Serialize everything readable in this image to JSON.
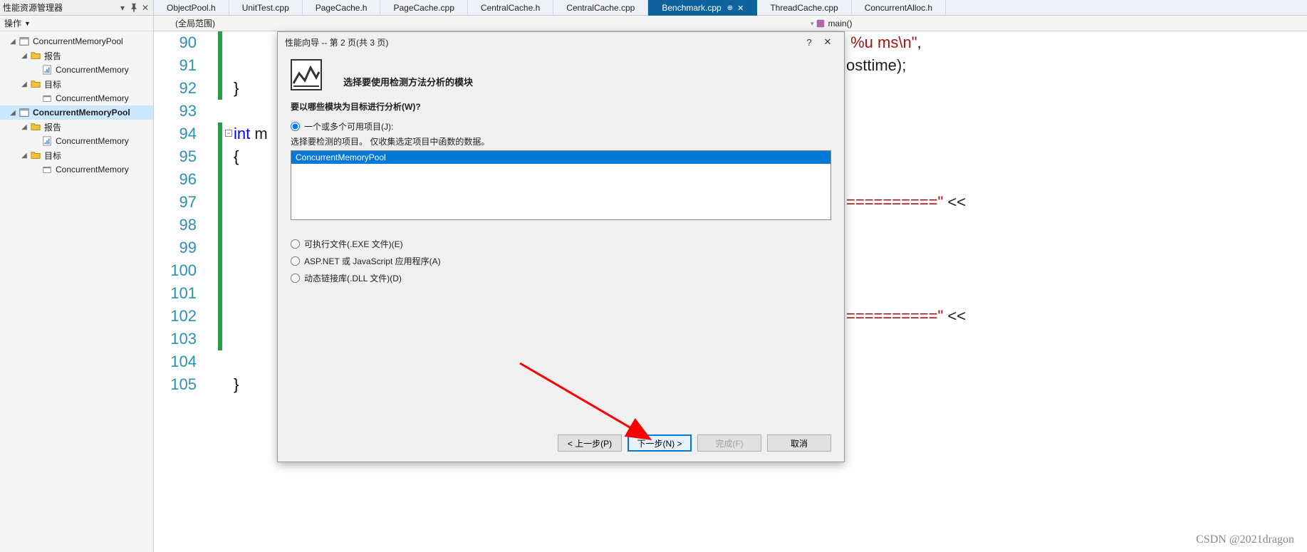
{
  "panel": {
    "title": "性能资源管理器",
    "ops": "操作",
    "tree": {
      "root1": "ConcurrentMemoryPool ",
      "reports": "报告",
      "report_item": "ConcurrentMemory",
      "targets": "目标",
      "target_item": "ConcurrentMemory",
      "root2": "ConcurrentMemoryPool",
      "reports2": "报告",
      "report_item2": "ConcurrentMemory",
      "targets2": "目标",
      "target_item2": "ConcurrentMemory"
    }
  },
  "tabs": [
    {
      "label": "ObjectPool.h"
    },
    {
      "label": "UnitTest.cpp"
    },
    {
      "label": "PageCache.h"
    },
    {
      "label": "PageCache.cpp"
    },
    {
      "label": "CentralCache.h"
    },
    {
      "label": "CentralCache.cpp"
    },
    {
      "label": "Benchmark.cpp",
      "active": true
    },
    {
      "label": "ThreadCache.cpp"
    },
    {
      "label": "ConcurrentAlloc.h"
    }
  ],
  "subbar": {
    "scope": "(全局范围)",
    "func": "main()"
  },
  "gutter": [
    "90",
    "91",
    "92",
    "93",
    "94",
    "95",
    "96",
    "97",
    "98",
    "99",
    "100",
    "101",
    "102",
    "103",
    "104",
    "105"
  ],
  "code": {
    "l90_str_right": " %u ms\\n\"",
    "l90_comma": ",",
    "l91_right": "osttime);",
    "l92": "}",
    "l94_kw": "int ",
    "l94_rest": "m",
    "l95": "{",
    "l97_str": "==========\"",
    "l97_op": " <<",
    "l102_str": "==========\"",
    "l102_op": " <<",
    "l105": "}"
  },
  "dialog": {
    "title": "性能向导 -- 第 2 页(共 3 页)",
    "subtitle": "选择要使用检测方法分析的模块",
    "question": "要以哪些模块为目标进行分析(W)?",
    "radio1": "一个或多个可用项目(J):",
    "note": "选择要检测的项目。  仅收集选定项目中函数的数据。",
    "list_item": "ConcurrentMemoryPool",
    "radio2": "可执行文件(.EXE 文件)(E)",
    "radio3": "ASP.NET 或 JavaScript 应用程序(A)",
    "radio4": "动态链接库(.DLL 文件)(D)",
    "btn_prev": "< 上一步(P)",
    "btn_next": "下一步(N) >",
    "btn_finish": "完成(F)",
    "btn_cancel": "取消"
  },
  "watermark": "CSDN @2021dragon"
}
